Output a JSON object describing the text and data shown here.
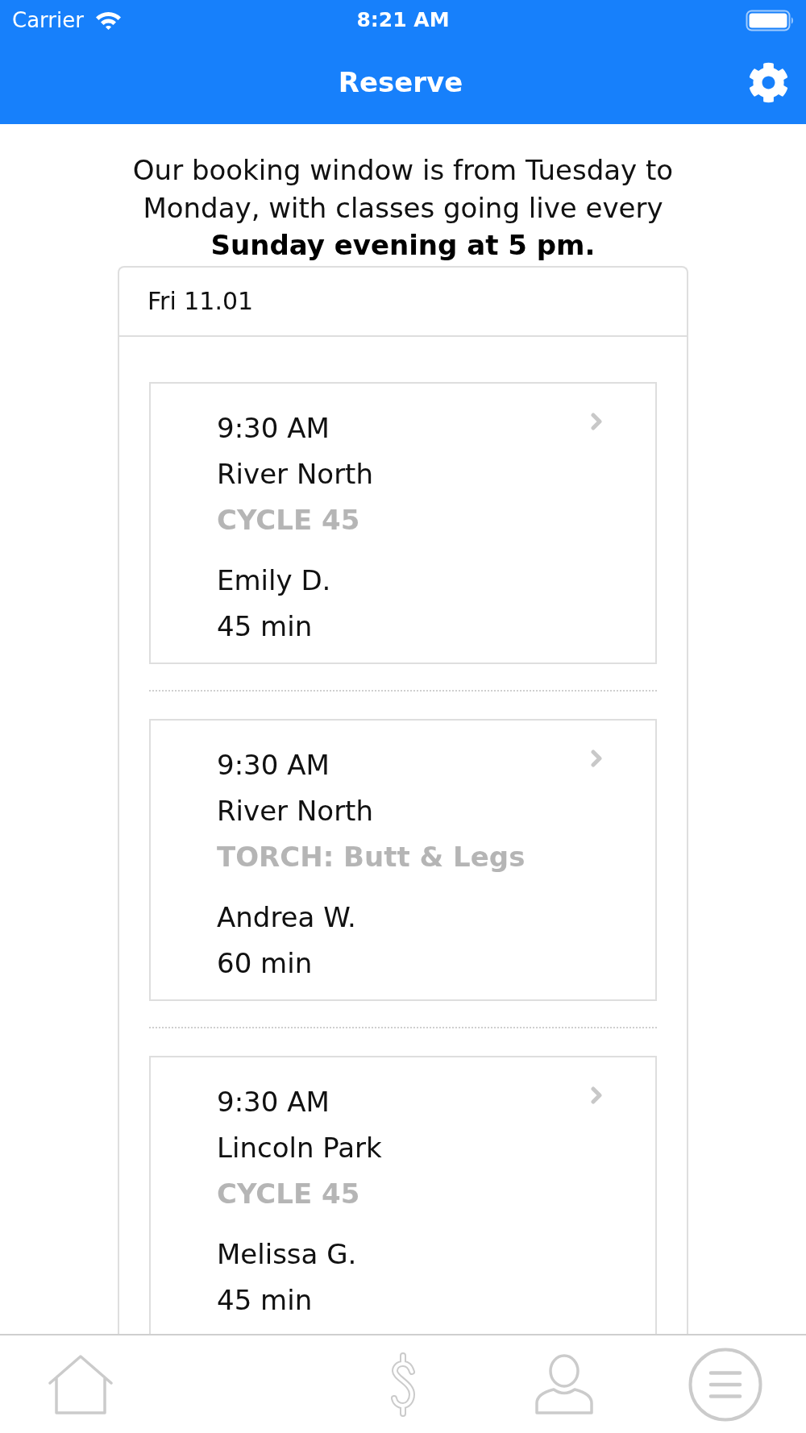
{
  "status_bar": {
    "carrier": "Carrier",
    "time": "8:21 AM"
  },
  "header": {
    "title": "Reserve"
  },
  "notice": "Our booking window is from Tuesday to Monday, with classes going live every **Sunday evening at 5 pm.**",
  "schedule": {
    "date": "Fri 11.01",
    "classes": [
      {
        "time": "9:30 AM",
        "location": "River North",
        "class_name": "CYCLE 45",
        "instructor": "Emily D.",
        "duration": "45 min"
      },
      {
        "time": "9:30 AM",
        "location": "River North",
        "class_name": "TORCH: Butt & Legs",
        "instructor": "Andrea W.",
        "duration": "60 min"
      },
      {
        "time": "9:30 AM",
        "location": "Lincoln Park",
        "class_name": "CYCLE 45",
        "instructor": "Melissa G.",
        "duration": "45 min"
      }
    ]
  }
}
